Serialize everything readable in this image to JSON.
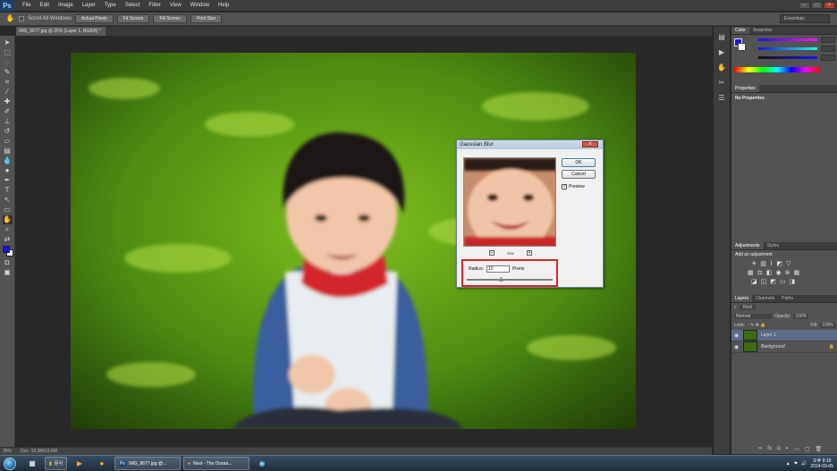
{
  "menubar": {
    "logo": "Ps",
    "items": [
      "File",
      "Edit",
      "Image",
      "Layer",
      "Type",
      "Select",
      "Filter",
      "View",
      "Window",
      "Help"
    ],
    "window_controls": [
      "–",
      "□",
      "×"
    ]
  },
  "options": {
    "scroll_all_windows": "Scroll All Windows",
    "actual_pixels": "Actual Pixels",
    "fit_screen": "Fit Screen",
    "fill_screen": "Fill Screen",
    "print_size": "Print Size",
    "workspace": "Essentials"
  },
  "document": {
    "tab_title": "IMG_9677.jpg @ 25% (Layer 1, RGB/8) *",
    "status_zoom": "25%",
    "status_doc": "Doc: 15.3M/19.6M"
  },
  "panels": {
    "color_tab": "Color",
    "swatches_tab": "Swatches",
    "properties_tab": "Properties",
    "no_properties": "No Properties",
    "adjustments_tab": "Adjustments",
    "styles_tab": "Styles",
    "add_adjustment": "Add an adjustment",
    "layers_tab": "Layers",
    "channels_tab": "Channels",
    "paths_tab": "Paths",
    "kind": "Kind",
    "blend_mode": "Normal",
    "opacity_label": "Opacity:",
    "opacity_value": "100%",
    "lock_label": "Lock:",
    "fill_label": "Fill:",
    "fill_value": "100%",
    "layers": [
      {
        "name": "Layer 1"
      },
      {
        "name": "Background"
      }
    ]
  },
  "dialog": {
    "title": "Gaussian Blur",
    "close": "x",
    "ok": "OK",
    "cancel": "Cancel",
    "preview": "Preview",
    "zoom": "25%",
    "radius_label": "Radius:",
    "radius_value": "10",
    "unit": "Pixels",
    "radius_fraction": 0.4
  },
  "taskbar": {
    "tasks": [
      {
        "label": "문서"
      },
      {
        "label": "IMG_9677.jpg @..."
      },
      {
        "label": "Nest - The Ocean..."
      }
    ],
    "time": "오후 9:10",
    "date": "2014-03-05"
  },
  "colors": {
    "foreground": "#1a14e0",
    "background": "#ffffff",
    "highlight": "#d22b2b"
  }
}
